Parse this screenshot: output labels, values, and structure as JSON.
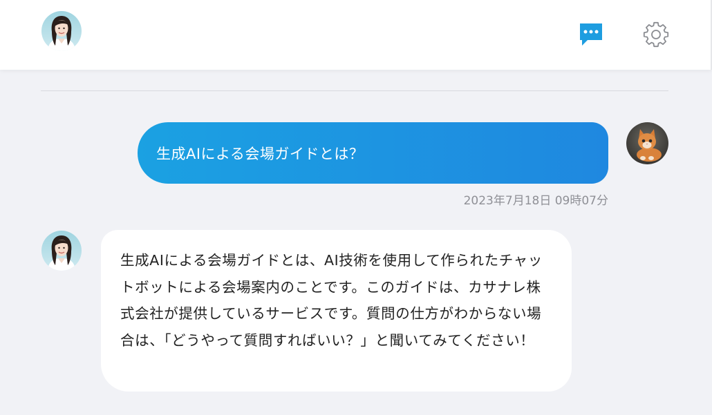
{
  "header": {
    "bot_avatar_icon": "woman-avatar",
    "chat_icon": "chat-bubble-icon",
    "settings_icon": "gear-icon",
    "accent_color": "#1e9de0"
  },
  "conversation": {
    "messages": [
      {
        "role": "user",
        "text": "生成AIによる会場ガイドとは？",
        "timestamp": "2023年7月18日 09時07分",
        "avatar_icon": "kitten-avatar"
      },
      {
        "role": "assistant",
        "text": "生成AIによる会場ガイドとは、AI技術を使用して作られたチャットボットによる会場案内のことです。このガイドは、カサナレ株式会社が提供しているサービスです。質問の仕方がわからない場合は、「どうやって質問すればいい？」と聞いてみてください！",
        "avatar_icon": "woman-avatar"
      }
    ]
  }
}
